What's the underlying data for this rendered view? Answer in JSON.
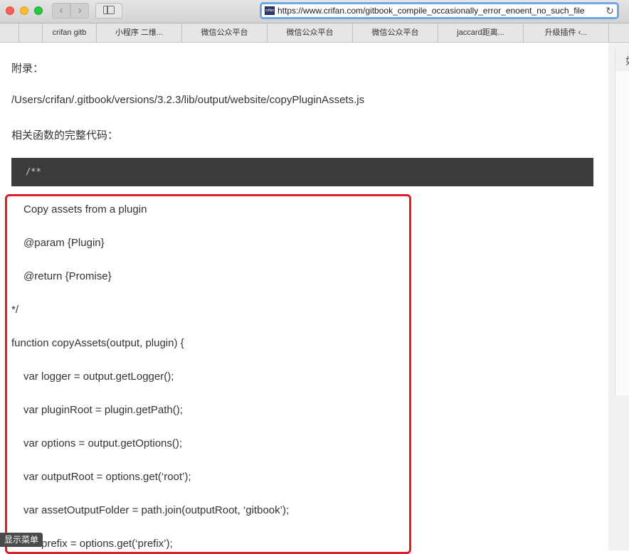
{
  "browser": {
    "url": "https://www.crifan.com/gitbook_compile_occasionally_error_enoent_no_such_file",
    "back_glyph": "‹",
    "forward_glyph": "›",
    "reload_glyph": "↻",
    "favicon_text": "crifan"
  },
  "bookmarks": [
    "",
    "",
    "crifan gitb",
    "小程序 二维...",
    "微信公众平台",
    "微信公众平台",
    "微信公众平台",
    "jaccard距离...",
    "升级插件 ‹..."
  ],
  "page": {
    "appendix_label": "附录：",
    "file_path": "/Users/crifan/.gitbook/versions/3.2.3/lib/output/website/copyPluginAssets.js",
    "full_code_label": "相关函数的完整代码：",
    "code_comment_open": "/**",
    "lines": [
      "Copy assets from a plugin",
      "@param {Plugin}",
      "@return {Promise}",
      "*/",
      "function copyAssets(output, plugin) {",
      "var logger = output.getLogger();",
      "var pluginRoot = plugin.getPath();",
      "var options = output.getOptions();",
      "var outputRoot = options.get(‘root’);",
      "var assetOutputFolder = path.join(outputRoot, ‘gitbook’);",
      "var prefix = options.get(‘prefix’);"
    ]
  },
  "right_panel": {
    "char": "如"
  },
  "menu_tag": "显示菜单",
  "colors": {
    "highlight": "#de1f26",
    "code_bg": "#3b3b3b",
    "url_focus": "#6fa6e6"
  }
}
